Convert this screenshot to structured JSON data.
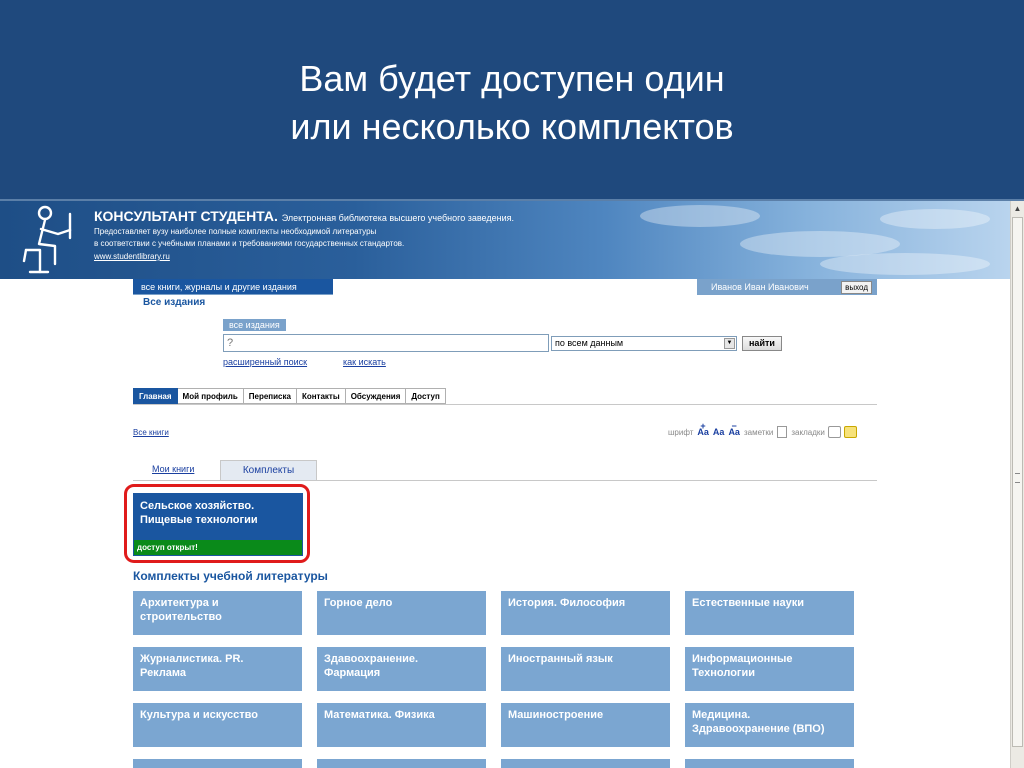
{
  "slide": {
    "title_line1": "Вам будет доступен один",
    "title_line2": "или несколько комплектов"
  },
  "site": {
    "brand": "КОНСУЛЬТАНТ СТУДЕНТА.",
    "tagline": "Электронная библиотека высшего учебного заведения.",
    "desc_line1": "Предоставляет вузу наиболее полные комплекты необходимой литературы",
    "desc_line2": "в соответствии с учебными планами и требованиями государственных стандартов.",
    "url": "www.studentlibrary.ru"
  },
  "topbar": {
    "scope_tab": "все книги, журналы и другие издания",
    "scope_sub": "Все издания",
    "user_name": "Иванов Иван Иванович",
    "logout": "выход"
  },
  "search": {
    "label": "все издания",
    "placeholder": "?",
    "scope": "по всем данным",
    "find": "найти",
    "advanced": "расширенный поиск",
    "howto": "как искать"
  },
  "nav": {
    "tabs": [
      "Главная",
      "Мой профиль",
      "Переписка",
      "Контакты",
      "Обсуждения",
      "Доступ"
    ]
  },
  "breadcrumb": "Все книги",
  "tools": {
    "font": "шрифт",
    "notes": "заметки",
    "bookmarks": "закладки",
    "aa": "Aa",
    "plus": "+",
    "minus": "−"
  },
  "book_tabs": {
    "my_books": "Мои книги",
    "sets": "Комплекты"
  },
  "open_set": {
    "title_line1": "Сельское хозяйство.",
    "title_line2": "Пищевые технологии",
    "status": "доступ открыт!"
  },
  "sets": {
    "heading": "Комплекты учебной литературы",
    "items": [
      {
        "line1": "Архитектура и",
        "line2": "строительство"
      },
      {
        "line1": "Горное дело",
        "line2": ""
      },
      {
        "line1": "История. Философия",
        "line2": ""
      },
      {
        "line1": "Естественные науки",
        "line2": ""
      },
      {
        "line1": "Журналистика. PR.",
        "line2": "Реклама"
      },
      {
        "line1": "Здавоохранение.",
        "line2": "Фармация"
      },
      {
        "line1": "Иностранный язык",
        "line2": ""
      },
      {
        "line1": "Информационные",
        "line2": "Технологии"
      },
      {
        "line1": "Культура и искусство",
        "line2": ""
      },
      {
        "line1": "Математика. Физика",
        "line2": ""
      },
      {
        "line1": "Машиностроение",
        "line2": ""
      },
      {
        "line1": "Медицина.",
        "line2": "Здравоохранение (ВПО)"
      }
    ]
  },
  "colors": {
    "slide_band": "#1f497d",
    "brand_blue": "#1a56a0",
    "set_card": "#7ba6d1",
    "open_status": "#0a8a1a",
    "highlight": "#e01b1b"
  }
}
